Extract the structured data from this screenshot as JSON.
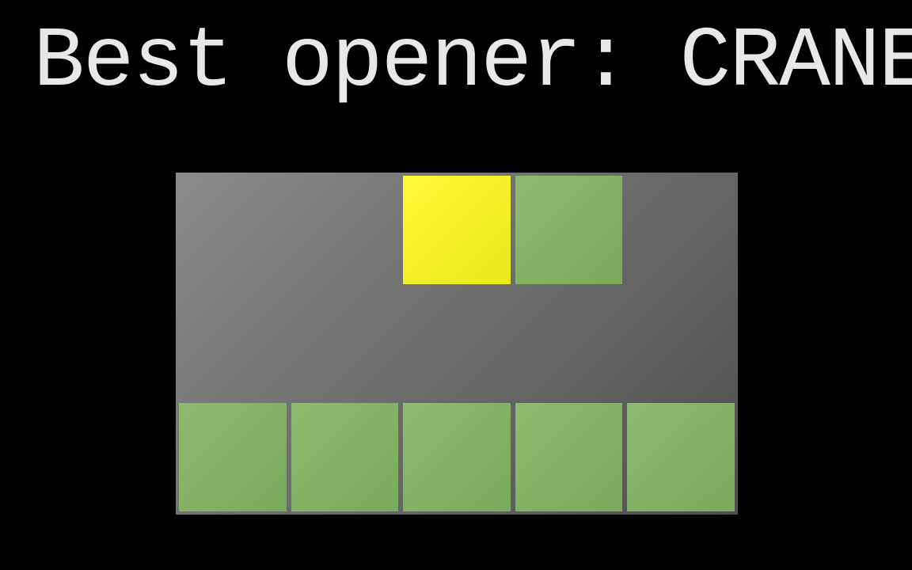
{
  "title": "Best opener: CRANE",
  "colors": {
    "gray": "transparent",
    "yellow": "#f5f51a",
    "green": "#83b060",
    "background": "#000000",
    "text": "#e8e8e8"
  },
  "board": {
    "rows": 3,
    "cols": 5,
    "cells": [
      [
        "gray",
        "gray",
        "yellow",
        "green",
        "gray"
      ],
      [
        "gray",
        "gray",
        "gray",
        "gray",
        "gray"
      ],
      [
        "green",
        "green",
        "green",
        "green",
        "green"
      ]
    ]
  }
}
